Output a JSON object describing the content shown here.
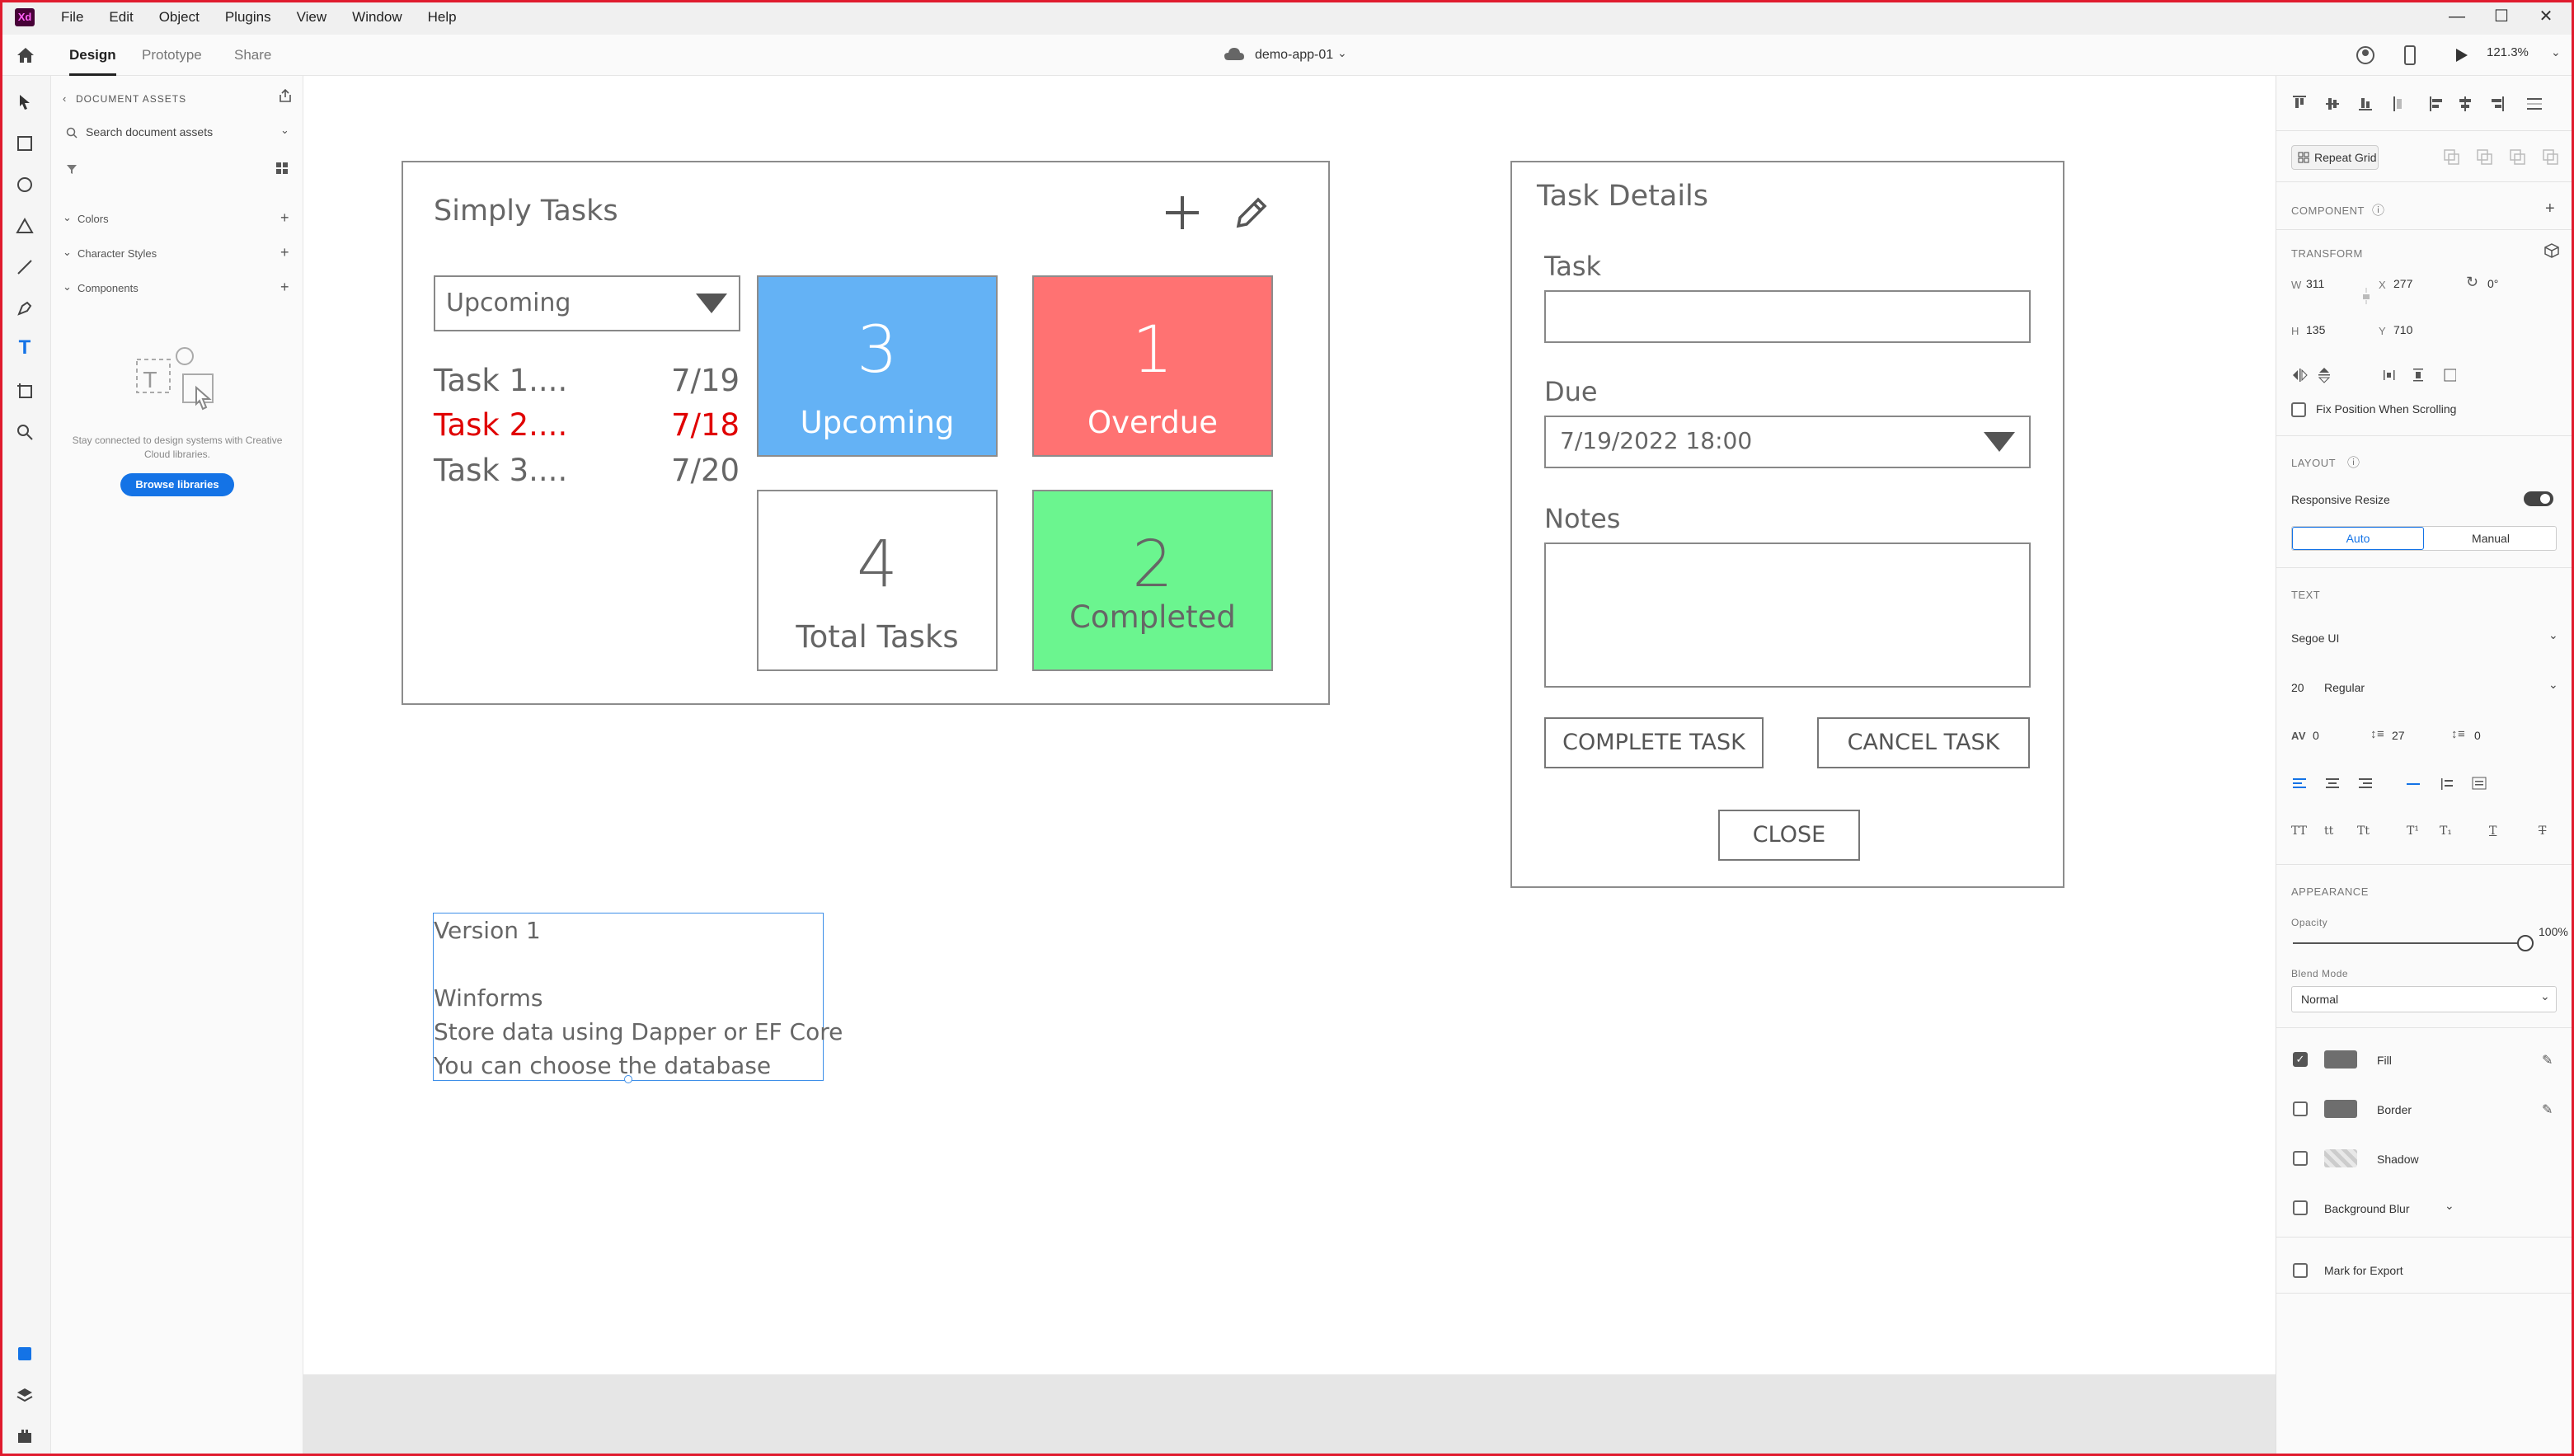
{
  "app": {
    "logo": "Xd",
    "menu": [
      "File",
      "Edit",
      "Object",
      "Plugins",
      "View",
      "Window",
      "Help"
    ],
    "window_controls": [
      "—",
      "☐",
      "✕"
    ]
  },
  "toolbar": {
    "tabs": [
      "Design",
      "Prototype",
      "Share"
    ],
    "document_title": "demo-app-01",
    "zoom": "121.3%"
  },
  "assets": {
    "header": "DOCUMENT ASSETS",
    "search_placeholder": "Search document assets",
    "sections": [
      "Colors",
      "Character Styles",
      "Components"
    ],
    "empty_message": "Stay connected to design systems with Creative Cloud libraries.",
    "browse_button": "Browse libraries"
  },
  "wireframe": {
    "main": {
      "title": "Simply Tasks",
      "filter_value": "Upcoming",
      "tasks": [
        {
          "name": "Task 1....",
          "date": "7/19",
          "overdue": false
        },
        {
          "name": "Task 2....",
          "date": "7/18",
          "overdue": true
        },
        {
          "name": "Task 3....",
          "date": "7/20",
          "overdue": false
        }
      ],
      "tiles": [
        {
          "count": "3",
          "label": "Upcoming",
          "color": "#64b2f5"
        },
        {
          "count": "1",
          "label": "Overdue",
          "color": "#ff7272"
        },
        {
          "count": "4",
          "label": "Total Tasks",
          "color": "#ffffff"
        },
        {
          "count": "2",
          "label": "Completed",
          "color": "#6bf58f"
        }
      ]
    },
    "details": {
      "title": "Task Details",
      "task_label": "Task",
      "due_label": "Due",
      "due_value": "7/19/2022 18:00",
      "notes_label": "Notes",
      "complete_button": "COMPLETE TASK",
      "cancel_button": "CANCEL TASK",
      "close_button": "CLOSE"
    },
    "notes": [
      "Version 1",
      "Winforms",
      "Store data using Dapper or EF Core",
      "You can choose the database"
    ]
  },
  "properties": {
    "repeat_grid": "Repeat Grid",
    "component_header": "COMPONENT",
    "transform_header": "TRANSFORM",
    "w_label": "W",
    "w_value": "311",
    "x_label": "X",
    "x_value": "277",
    "rotation_value": "0°",
    "h_label": "H",
    "h_value": "135",
    "y_label": "Y",
    "y_value": "710",
    "fix_position": "Fix Position When Scrolling",
    "layout_header": "LAYOUT",
    "responsive_resize": "Responsive Resize",
    "layout_options": [
      "Auto",
      "Manual"
    ],
    "text_header": "TEXT",
    "font_family": "Segoe UI",
    "font_size": "20",
    "font_weight": "Regular",
    "char_spacing": "0",
    "line_spacing": "27",
    "para_spacing": "0",
    "appearance_header": "APPEARANCE",
    "opacity_label": "Opacity",
    "opacity_value": "100%",
    "opacity": 1.0,
    "blend_label": "Blend Mode",
    "blend_value": "Normal",
    "fill_label": "Fill",
    "border_label": "Border",
    "shadow_label": "Shadow",
    "background_blur": "Background Blur",
    "mark_export": "Mark for Export"
  },
  "colors": {
    "accent_blue": "#1473e6",
    "frame_red": "#e01b2e",
    "overdue_red": "#e00000"
  }
}
